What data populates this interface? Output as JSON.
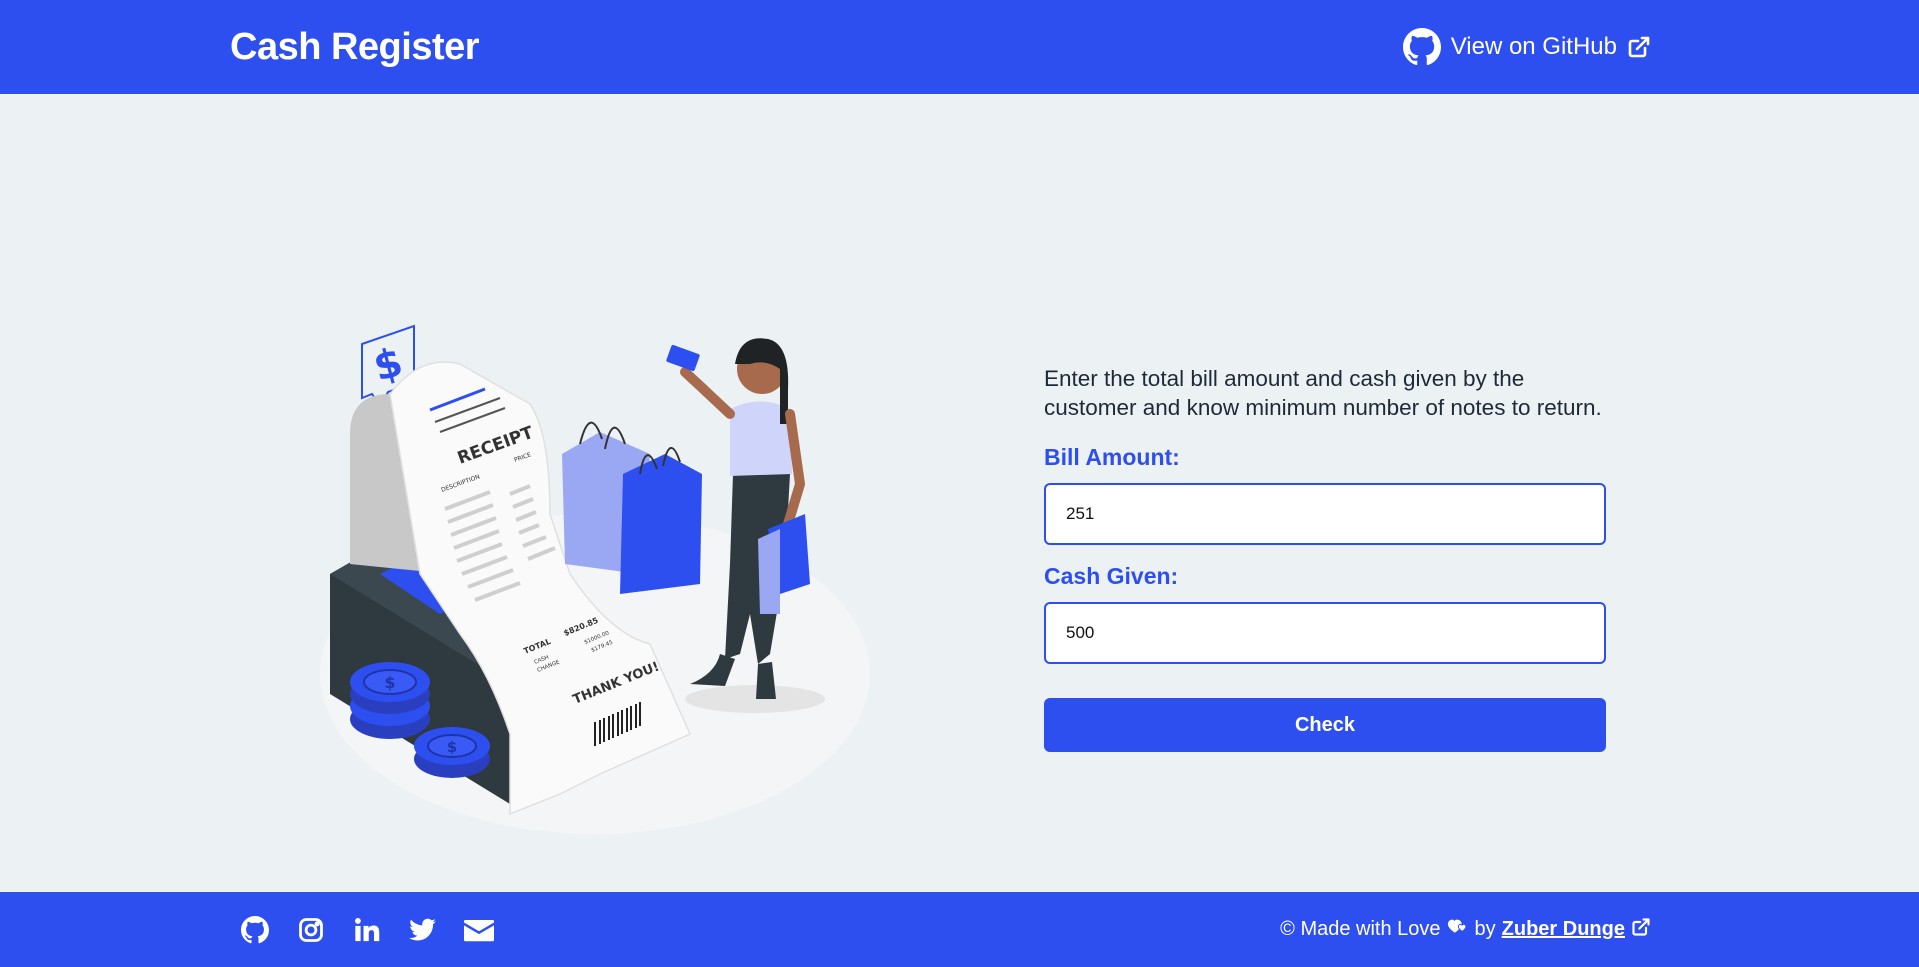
{
  "header": {
    "title": "Cash Register",
    "github_link_label": "View on GitHub"
  },
  "main": {
    "intro": "Enter the total bill amount and cash given by the customer and know minimum number of notes to return.",
    "bill_label": "Bill Amount:",
    "bill_value": "251",
    "cash_label": "Cash Given:",
    "cash_value": "500",
    "check_label": "Check"
  },
  "illustration": {
    "receipt_title": "RECEIPT",
    "receipt_description": "DESCRIPTION",
    "receipt_price": "PRICE",
    "total_label": "TOTAL",
    "total_value": "$820.85",
    "cash_label": "CASH",
    "cash_value": "$1000.00",
    "change_label": "CHANGE",
    "change_value": "$179.45",
    "thanks": "THANK YOU!",
    "dollar_sign": "$"
  },
  "footer": {
    "made_with": "© Made with Love",
    "by": "by",
    "author": "Zuber Dunge",
    "socials": [
      "github-icon",
      "instagram-icon",
      "linkedin-icon",
      "twitter-icon",
      "mail-icon"
    ]
  },
  "colors": {
    "accent": "#2e4ff0",
    "background": "#ecf1f4"
  }
}
